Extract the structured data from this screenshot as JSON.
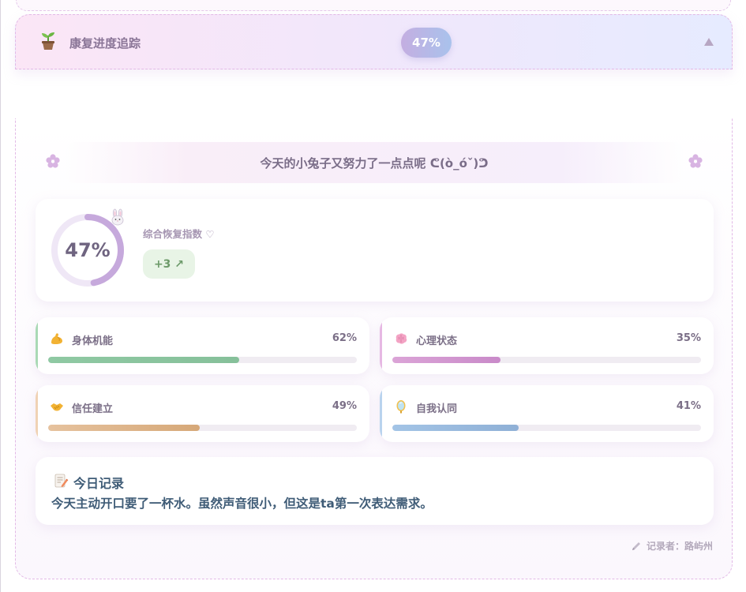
{
  "header": {
    "title": "康复进度追踪",
    "badge": "47%",
    "icons": {
      "sprout": "sprout-icon",
      "collapse": "triangle-up-icon"
    }
  },
  "motto": "今天的小兔子又努力了一点点呢 ᕦ(ò_óˇ)ᕤ",
  "summary": {
    "value_text": "47%",
    "value": 47,
    "label": "综合恢复指数 ♡",
    "delta": "+3 ↗"
  },
  "metrics": [
    {
      "label": "身体机能",
      "value_text": "62%",
      "value": 62,
      "icon": "flexed-biceps-icon",
      "color": "#8fc9a3",
      "color_end": "#86c09a"
    },
    {
      "label": "心理状态",
      "value_text": "35%",
      "value": 35,
      "icon": "brain-icon",
      "color": "#dba4d7",
      "color_end": "#c98ac9"
    },
    {
      "label": "信任建立",
      "value_text": "49%",
      "value": 49,
      "icon": "handshake-icon",
      "color": "#e6c29e",
      "color_end": "#d6a878"
    },
    {
      "label": "自我认同",
      "value_text": "41%",
      "value": 41,
      "icon": "mirror-icon",
      "color": "#a3c4e6",
      "color_end": "#8fb0d6"
    }
  ],
  "note": {
    "title": "今日记录",
    "text": "今天主动开口要了一杯水。虽然声音很小，但这是ta第一次表达需求。"
  },
  "recorder": "记录者：路屿州",
  "colors": {
    "accent_purple": "#c6a9dc",
    "ring_track": "#efe7f6",
    "dashed_border": "#e2b9e6"
  }
}
